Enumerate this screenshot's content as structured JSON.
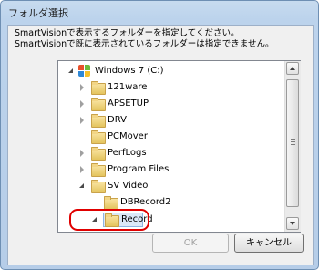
{
  "window": {
    "title": "フォルダ選択"
  },
  "description": {
    "line1": "SmartVisionで表示するフォルダーを指定してください。",
    "line2": "SmartVisionで既に表示されているフォルダーは指定できません。"
  },
  "tree": {
    "items": [
      {
        "label": "Windows 7 (C:)",
        "expander": "expanded",
        "icon": "windows-drive-icon"
      },
      {
        "label": "121ware",
        "expander": "collapsed",
        "icon": "folder-icon"
      },
      {
        "label": "APSETUP",
        "expander": "collapsed",
        "icon": "folder-icon"
      },
      {
        "label": "DRV",
        "expander": "collapsed",
        "icon": "folder-icon"
      },
      {
        "label": "PCMover",
        "expander": "none",
        "icon": "folder-icon"
      },
      {
        "label": "PerfLogs",
        "expander": "collapsed",
        "icon": "folder-icon"
      },
      {
        "label": "Program Files",
        "expander": "collapsed",
        "icon": "folder-icon"
      },
      {
        "label": "SV Video",
        "expander": "expanded",
        "icon": "folder-icon"
      },
      {
        "label": "DBRecord2",
        "expander": "none",
        "icon": "folder-icon"
      },
      {
        "label": "Record",
        "expander": "expanded",
        "icon": "folder-icon",
        "selected": true
      }
    ]
  },
  "buttons": {
    "ok": "OK",
    "cancel": "キャンセル"
  },
  "colors": {
    "highlight": "#e00000",
    "selection": "#dbe8f8"
  }
}
